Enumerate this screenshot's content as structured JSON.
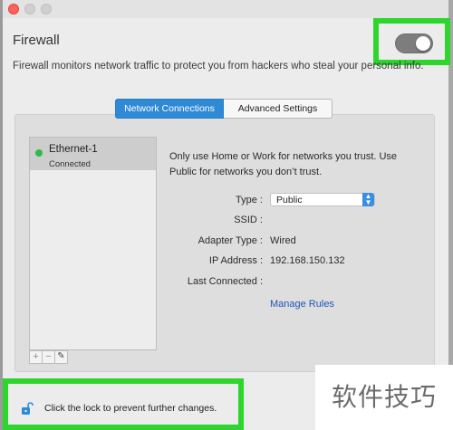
{
  "window": {
    "title": "Firewall",
    "description": "Firewall monitors network traffic to protect you from hackers who steal your personal info.",
    "firewall_enabled": false
  },
  "tabs": [
    {
      "label": "Network Connections",
      "selected": true
    },
    {
      "label": "Advanced Settings",
      "selected": false
    }
  ],
  "connections": [
    {
      "name": "Ethernet-1",
      "status": "Connected",
      "status_color": "#2fb94b"
    }
  ],
  "list_toolbar": {
    "add": "+",
    "remove": "−",
    "edit_icon": "pencil-icon"
  },
  "details": {
    "intro": "Only use Home or Work for networks you trust. Use Public for networks you don’t trust.",
    "type_label": "Type :",
    "type_value": "Public",
    "ssid_label": "SSID :",
    "ssid_value": "",
    "adapter_label": "Adapter Type :",
    "adapter_value": "Wired",
    "ip_label": "IP Address :",
    "ip_value": "192.168.150.132",
    "last_label": "Last Connected :",
    "last_value": "",
    "manage_link": "Manage Rules"
  },
  "footer": {
    "lock_text": "Click the lock to prevent further changes.",
    "lock_icon": "lock-open-icon"
  },
  "watermark": "软件技巧",
  "colors": {
    "accent": "#2f8ad5",
    "highlight": "#2dd52d",
    "link": "#1e57b5"
  }
}
